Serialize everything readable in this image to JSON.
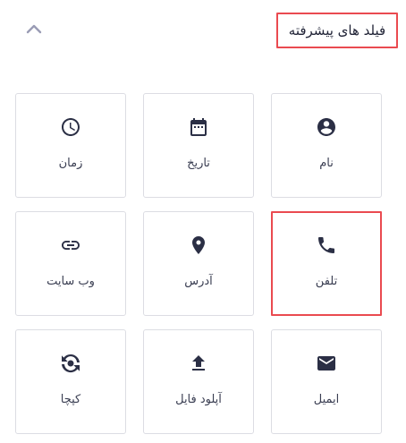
{
  "header": {
    "title": "فیلد های پیشرفته"
  },
  "fields": [
    {
      "label": "نام",
      "icon": "account-circle-icon"
    },
    {
      "label": "تاریخ",
      "icon": "calendar-icon"
    },
    {
      "label": "زمان",
      "icon": "clock-icon"
    },
    {
      "label": "تلفن",
      "icon": "phone-icon"
    },
    {
      "label": "آدرس",
      "icon": "location-pin-icon"
    },
    {
      "label": "وب سایت",
      "icon": "link-icon"
    },
    {
      "label": "ایمیل",
      "icon": "mail-icon"
    },
    {
      "label": "آپلود فایل",
      "icon": "upload-icon"
    },
    {
      "label": "کپچا",
      "icon": "captcha-icon"
    }
  ],
  "colors": {
    "highlight": "#ea4a50",
    "icon": "#2b2f45",
    "card_border": "#dcdde3",
    "chevron": "#9a9cb5"
  }
}
